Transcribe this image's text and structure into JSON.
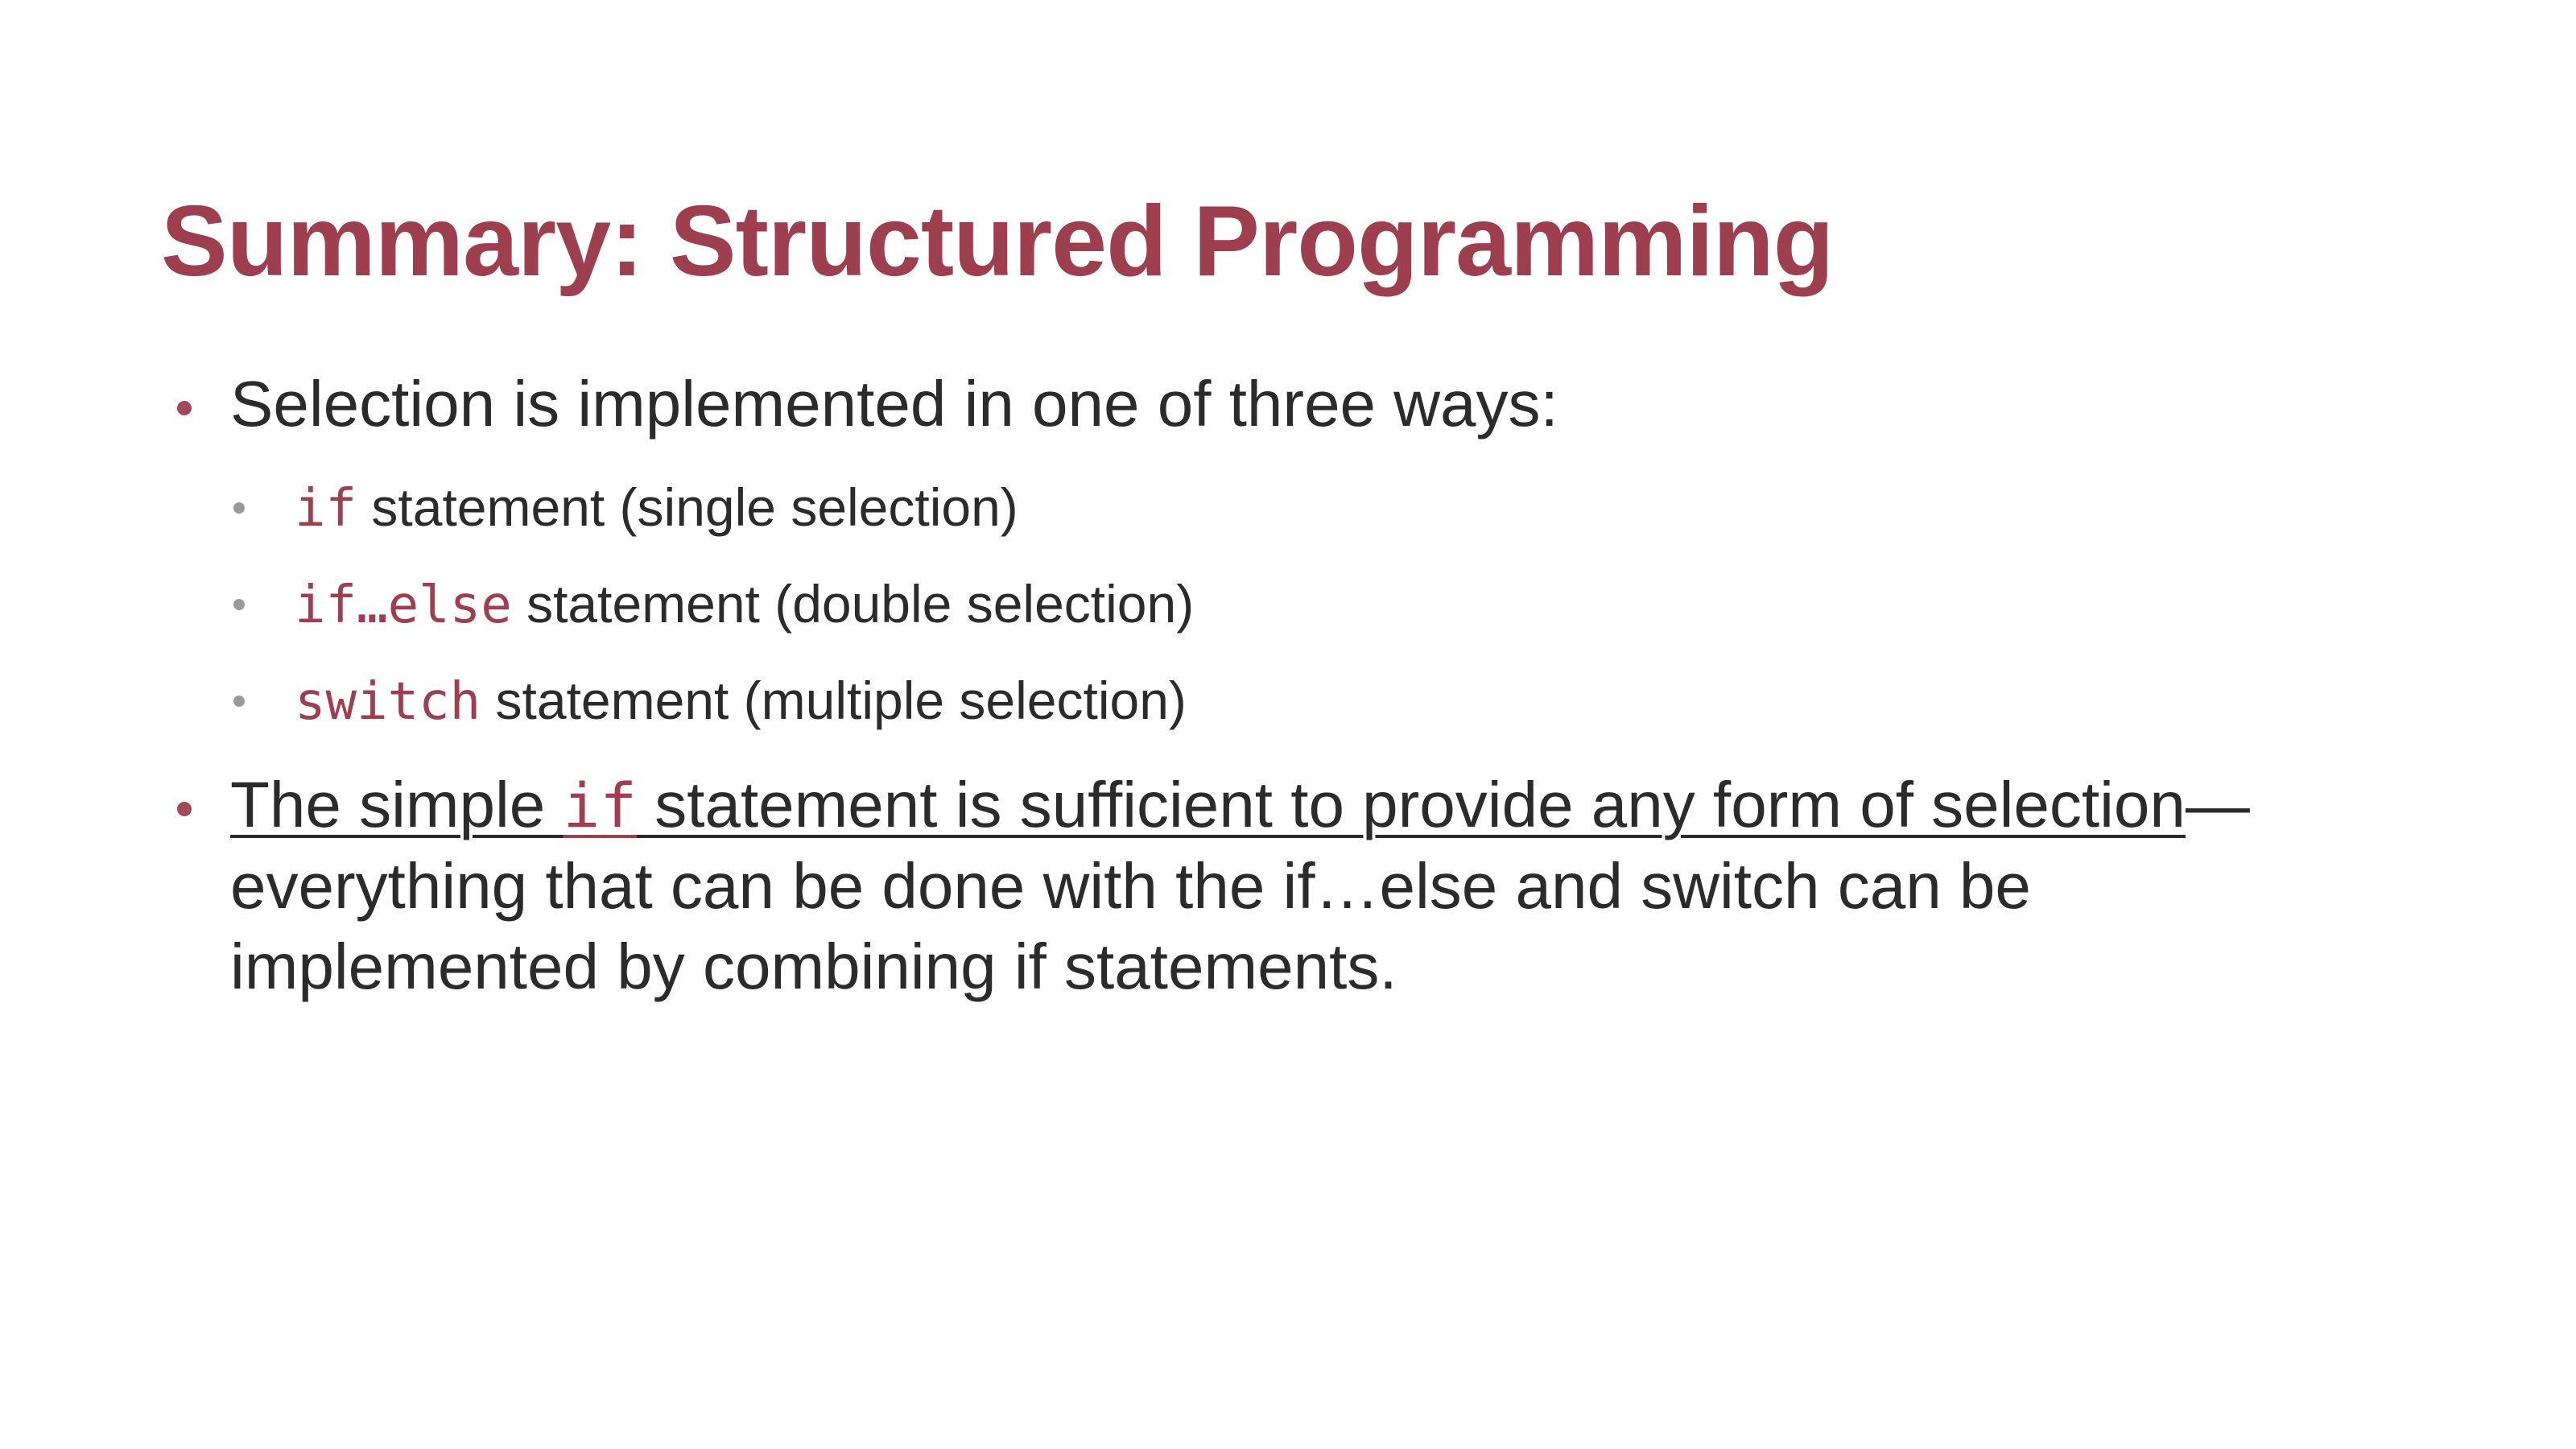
{
  "slide": {
    "title": "Summary: Structured Programming",
    "bullet1": {
      "text": "Selection is implemented in one of three ways:",
      "subitems": [
        {
          "code": "if",
          "text": "statement (single selection)"
        },
        {
          "code": "if…else",
          "text": "statement (double selection)"
        },
        {
          "code": "switch",
          "text": "statement (multiple selection)"
        }
      ]
    },
    "bullet2": {
      "underlined_prefix": "The simple ",
      "code": "if",
      "underlined_suffix": " statement is sufficient to provide any form of selection",
      "rest": "—everything that can be done with the if…else and switch can be implemented by combining if statements."
    }
  },
  "colors": {
    "accent": "#9e3f50",
    "text": "#2b2b2b",
    "sub_bullet": "#9a9a9a"
  }
}
